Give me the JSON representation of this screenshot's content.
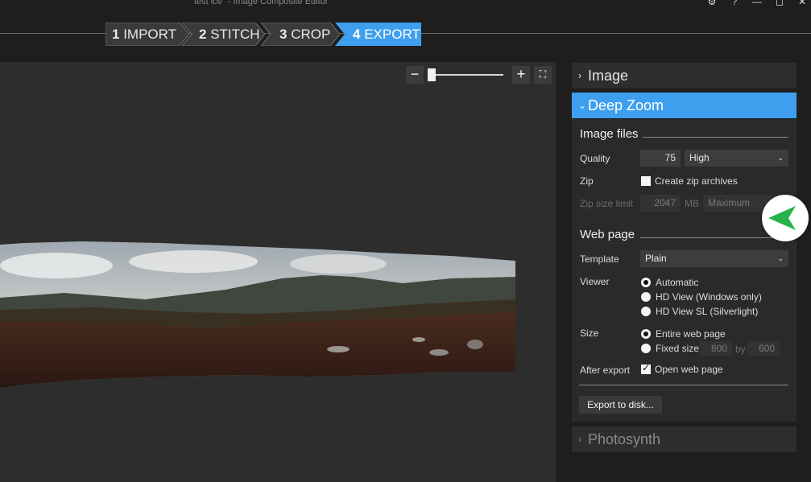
{
  "window": {
    "title": "\"test ice\" - Image Composite Editor",
    "controls": [
      "⚙",
      "?",
      "—",
      "◻",
      "✕"
    ]
  },
  "steps": [
    {
      "num": "1",
      "label": "IMPORT"
    },
    {
      "num": "2",
      "label": "STITCH"
    },
    {
      "num": "3",
      "label": "CROP"
    },
    {
      "num": "4",
      "label": "EXPORT"
    }
  ],
  "zoom": {
    "minus": "−",
    "plus": "+",
    "fit": "⛶"
  },
  "panels": {
    "image": {
      "chevron": "›",
      "label": "Image"
    },
    "deep_zoom": {
      "chevron": "⌄",
      "label": "Deep Zoom"
    },
    "photosynth": {
      "chevron": "›",
      "label": "Photosynth"
    }
  },
  "image_files": {
    "title": "Image files",
    "quality_label": "Quality",
    "quality_value": "75",
    "quality_preset": "High",
    "zip_label": "Zip",
    "zip_checkbox": "Create zip archives",
    "zip_size_label": "Zip size limit",
    "zip_size_value": "2047",
    "zip_size_unit": "MB",
    "zip_size_preset": "Maximum"
  },
  "web_page": {
    "title": "Web page",
    "template_label": "Template",
    "template_value": "Plain",
    "viewer_label": "Viewer",
    "viewer_options": [
      "Automatic",
      "HD View (Windows only)",
      "HD View SL (Silverlight)"
    ],
    "size_label": "Size",
    "size_options": [
      "Entire web page",
      "Fixed size:"
    ],
    "width": "800",
    "by": "by",
    "height": "600",
    "after_export_label": "After export",
    "after_export_checkbox": "Open web page"
  },
  "export_button": "Export to disk...",
  "colors": {
    "accent": "#3f9fef",
    "background": "#1e1e1e",
    "canvas": "#2d2d2d",
    "fab_arrow": "#27b24a"
  }
}
